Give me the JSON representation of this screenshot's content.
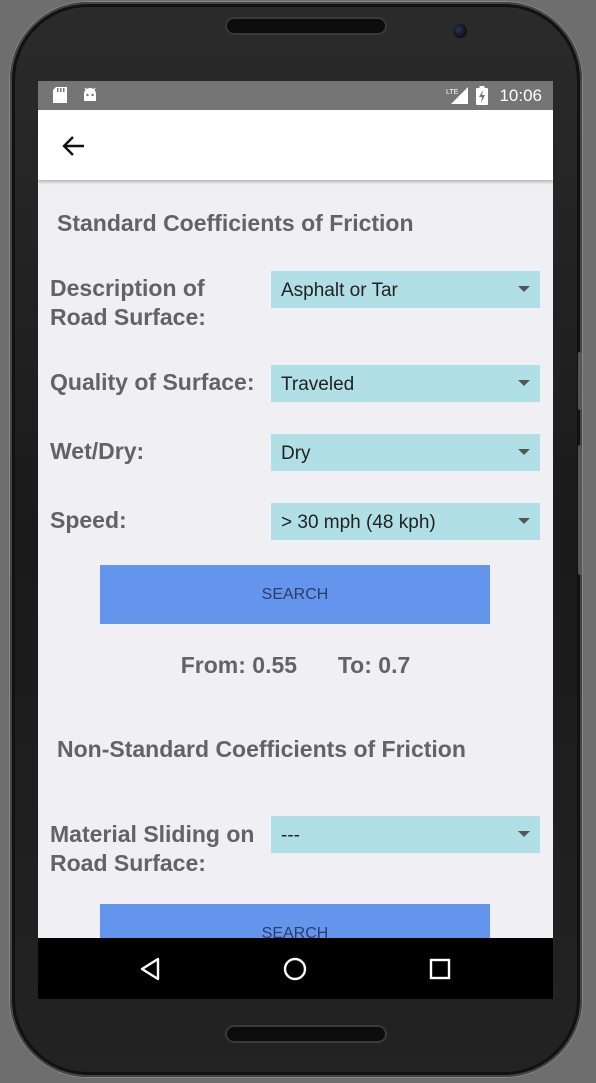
{
  "status_bar": {
    "time": "10:06",
    "icons": [
      "sd-card-icon",
      "android-icon",
      "lte-signal-icon",
      "battery-charging-icon"
    ],
    "network_label": "LTE"
  },
  "app_bar": {
    "back_icon": "arrow-back-icon"
  },
  "standard": {
    "title": "Standard Coefficients of Friction",
    "fields": [
      {
        "label": "Description of Road Surface:",
        "value": "Asphalt or Tar"
      },
      {
        "label": "Quality of Surface:",
        "value": "Traveled"
      },
      {
        "label": "Wet/Dry:",
        "value": "Dry"
      },
      {
        "label": "Speed:",
        "value": "> 30 mph (48 kph)"
      }
    ],
    "search_label": "SEARCH",
    "result_from": "From: 0.55",
    "result_to": "To: 0.7"
  },
  "non_standard": {
    "title": "Non-Standard Coefficients of Friction",
    "fields": [
      {
        "label": "Material Sliding on Road Surface:",
        "value": "---"
      }
    ],
    "search_label": "SEARCH"
  },
  "nav_bar": {
    "icons": [
      "back-triangle-icon",
      "home-circle-icon",
      "recents-square-icon"
    ]
  },
  "colors": {
    "dropdown_bg": "#b0e0e6",
    "button_bg": "#6495ed",
    "label_text": "#636363",
    "screen_bg": "#efeff4",
    "status_bar": "#757575"
  }
}
